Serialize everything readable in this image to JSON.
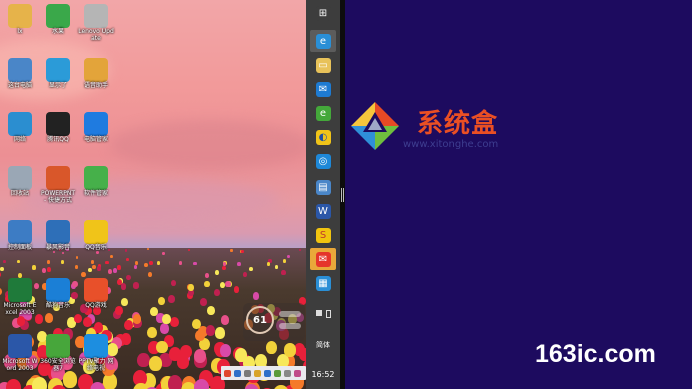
{
  "desktop_icons": [
    {
      "label": "lx",
      "icon": "folder-icon",
      "color": "#e6b34a"
    },
    {
      "label": "水果",
      "icon": "app-icon",
      "color": "#3aa84a"
    },
    {
      "label": "Lenovo Update",
      "icon": "lenovo-update-icon",
      "color": "#b5b5b5"
    },
    {
      "label": "这台电脑",
      "icon": "computer-icon",
      "color": "#4a86c8"
    },
    {
      "label": "显示了",
      "icon": "refresh-icon",
      "color": "#2b9bd8"
    },
    {
      "label": "语音助手",
      "icon": "app-icon",
      "color": "#e3a43a"
    },
    {
      "label": "网络",
      "icon": "network-icon",
      "color": "#2b8ed0"
    },
    {
      "label": "腾讯QQ",
      "icon": "qq-icon",
      "color": "#222222"
    },
    {
      "label": "电脑管家",
      "icon": "shield-icon",
      "color": "#1f7be0"
    },
    {
      "label": "回收站",
      "icon": "recycle-bin-icon",
      "color": "#9aa7b5"
    },
    {
      "label": "POWERPNT - 快捷方式",
      "icon": "powerpoint-icon",
      "color": "#d9572a"
    },
    {
      "label": "软件管家",
      "icon": "pinwheel-icon",
      "color": "#46b04a"
    },
    {
      "label": "控制面板",
      "icon": "control-panel-icon",
      "color": "#3d7cc4"
    },
    {
      "label": "暴风影音",
      "icon": "media-player-icon",
      "color": "#2e6fb8"
    },
    {
      "label": "QQ音乐",
      "icon": "qq-music-icon",
      "color": "#f0c419"
    },
    {
      "label": "Microsoft Excel 2003",
      "icon": "excel-icon",
      "color": "#1f7a3a"
    },
    {
      "label": "酷狗音乐",
      "icon": "kugou-icon",
      "color": "#1b7fd6"
    },
    {
      "label": "QQ游戏",
      "icon": "qq-game-icon",
      "color": "#e8502a"
    },
    {
      "label": "Microsoft Word 2003",
      "icon": "word-icon",
      "color": "#2b57a8"
    },
    {
      "label": "360安全浏览器7",
      "icon": "browser-360-icon",
      "color": "#47a63b"
    },
    {
      "label": "PPTV聚力 网络电视",
      "icon": "pptv-icon",
      "color": "#1d8ee0"
    }
  ],
  "weather_widget": {
    "value": "61"
  },
  "appbar": {
    "tiles": [
      {
        "name": "windows-start-icon",
        "glyph": "⊞",
        "bg": "#3d3d3d",
        "fg": "#ffffff"
      },
      {
        "name": "ie-icon",
        "glyph": "e",
        "bg": "#2a8fd6",
        "fg": "#ffffff"
      },
      {
        "name": "file-explorer-icon",
        "glyph": "▭",
        "bg": "#e8c25a",
        "fg": "#ffffff"
      },
      {
        "name": "mail-icon",
        "glyph": "✉",
        "bg": "#1e7bd2",
        "fg": "#ffffff"
      },
      {
        "name": "browser-360-icon",
        "glyph": "e",
        "bg": "#44a83a",
        "fg": "#ffffff"
      },
      {
        "name": "qq-browser-icon",
        "glyph": "◐",
        "bg": "#f0c419",
        "fg": "#1f4fa0"
      },
      {
        "name": "qq-chat-icon",
        "glyph": "◎",
        "bg": "#1e88d8",
        "fg": "#ffffff"
      },
      {
        "name": "network-icon",
        "glyph": "▤",
        "bg": "#4a86c8",
        "fg": "#ffffff"
      },
      {
        "name": "word-icon",
        "glyph": "W",
        "bg": "#2b57a8",
        "fg": "#ffffff"
      },
      {
        "name": "sogou-icon",
        "glyph": "S",
        "bg": "#f1c40f",
        "fg": "#c0392b"
      },
      {
        "name": "foxmail-icon",
        "glyph": "✉",
        "bg": "#e5352b",
        "fg": "#ffffff"
      },
      {
        "name": "image-viewer-icon",
        "glyph": "▦",
        "bg": "#2a8fd6",
        "fg": "#ffffff"
      }
    ],
    "ime_label": "简体",
    "time": "16:52"
  },
  "start_pane": {
    "brand_text": "系统盒",
    "brand_url": "www.xitonghe.com",
    "watermark": "163ic.com",
    "bg_color": "#1d0b5f",
    "brand_color": "#ea4f24"
  }
}
